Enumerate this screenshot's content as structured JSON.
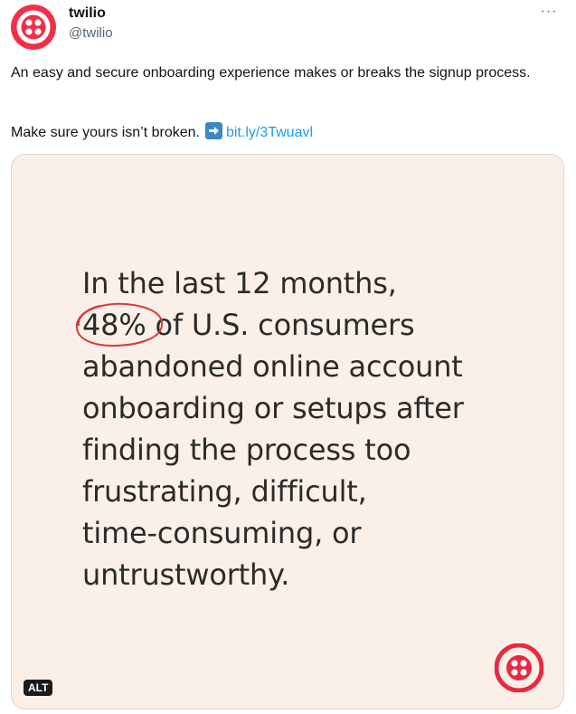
{
  "author": {
    "display_name": "twilio",
    "handle": "@twilio",
    "avatar_icon": "twilio-logo-icon",
    "brand_color": "#f22f46"
  },
  "header": {
    "more_label": "···"
  },
  "tweet": {
    "text_line1": "An easy and secure onboarding experience makes or breaks the signup process.",
    "text_line2": "Make sure yours isn’t broken.",
    "emoji_icon": "right-arrow-emoji-icon",
    "link_text": "bit.ly/3Twuavl",
    "link_color": "#1d9bf0"
  },
  "media": {
    "background_color": "#fbf0e7",
    "text_lines": [
      "In the last 12 months,",
      "48%",
      " of U.S. consumers",
      "abandoned online account",
      "onboarding or setups after",
      "finding the process too",
      "frustrating, difficult,",
      "time-consuming, or",
      "untrustworthy."
    ],
    "highlight_circle_color": "#d9383f",
    "alt_badge": "ALT",
    "logo_icon": "twilio-logo-icon"
  }
}
